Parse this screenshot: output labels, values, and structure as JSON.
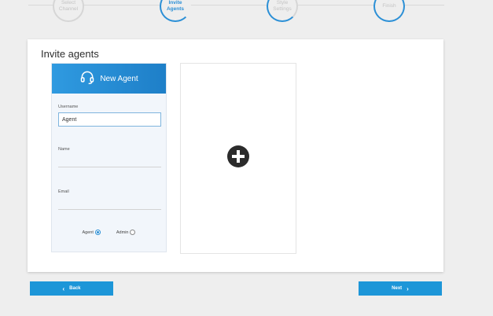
{
  "stepper": {
    "steps": [
      {
        "label": "Select\nChannel"
      },
      {
        "label": "Invite\nAgents"
      },
      {
        "label": "Style\nSettings"
      },
      {
        "label": "Finish"
      }
    ]
  },
  "card": {
    "title": "Invite agents"
  },
  "agent_form": {
    "header": "New Agent",
    "username_label": "Username",
    "username_value": "Agent",
    "name_label": "Name",
    "email_label": "Email",
    "role_agent": "Agent",
    "role_admin": "Admin"
  },
  "nav": {
    "back_label": "Back",
    "next_label": "Next"
  },
  "colors": {
    "accent": "#1d96d8"
  }
}
